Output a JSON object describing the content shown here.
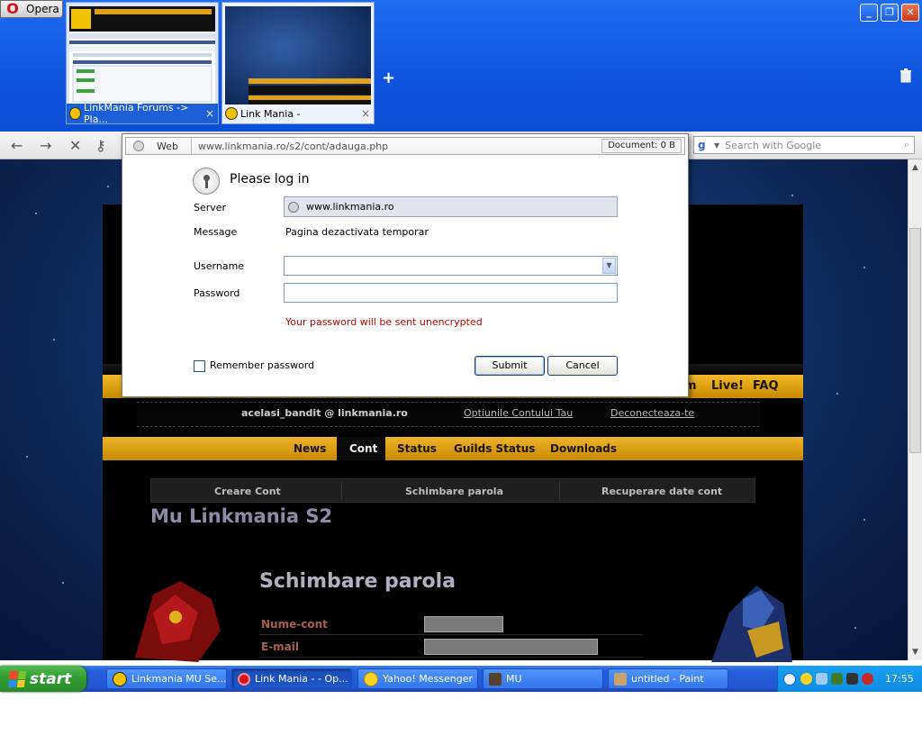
{
  "opera": {
    "button_label": "Opera"
  },
  "tabs": [
    {
      "title": "LinkMania Forums -> Pla...",
      "close": "×"
    },
    {
      "title": "Link Mania -",
      "close": "×"
    }
  ],
  "newtab_symbol": "+",
  "window_controls": {
    "min": "_",
    "max": "❐",
    "close": "✕"
  },
  "nav": {
    "back": "←",
    "forward": "→",
    "stop": "✕",
    "wand": "⚷"
  },
  "search": {
    "placeholder": "Search with Google",
    "icon_letter": "g"
  },
  "dialog": {
    "url_zone": "Web",
    "url": "www.linkmania.ro/s2/cont/adauga.php",
    "document_info": "Document:   0 B",
    "title": "Please log in",
    "server_label": "Server",
    "server_value": "www.linkmania.ro",
    "message_label": "Message",
    "message_value": "Pagina dezactivata temporar",
    "username_label": "Username",
    "username_value": "",
    "password_label": "Password",
    "password_value": "",
    "warning": "Your password will be sent unencrypted",
    "remember_label": "Remember password",
    "submit_label": "Submit",
    "cancel_label": "Cancel"
  },
  "site": {
    "top_nav_fragment": "m",
    "top_nav": [
      "Live!",
      "FAQ"
    ],
    "user_email": "acelasi_bandit @ linkmania.ro",
    "account_options": "Optiunile Contului Tau",
    "logout": "Deconecteaza-te",
    "menu": [
      "News",
      "Cont",
      "Status",
      "Guilds Status",
      "Downloads"
    ],
    "submenu": [
      "Creare Cont",
      "Schimbare parola",
      "Recuperare date cont"
    ],
    "title": "Mu Linkmania S2",
    "form_title": "Schimbare parola",
    "form_labels": [
      "Nume-cont",
      "E-mail"
    ]
  },
  "taskbar": {
    "start_label": "start",
    "tasks": [
      {
        "label": "Linkmania MU Se...",
        "active": false
      },
      {
        "label": "Link Mania - - Op...",
        "active": true
      },
      {
        "label": "Yahoo! Messenger",
        "active": false
      },
      {
        "label": "MU",
        "active": false
      },
      {
        "label": "untitled - Paint",
        "active": false
      }
    ],
    "clock": "17:55"
  },
  "colors": {
    "warning": "#c00000",
    "menu_gold": "#e8a81c",
    "taskbar_blue": "#245edb"
  }
}
